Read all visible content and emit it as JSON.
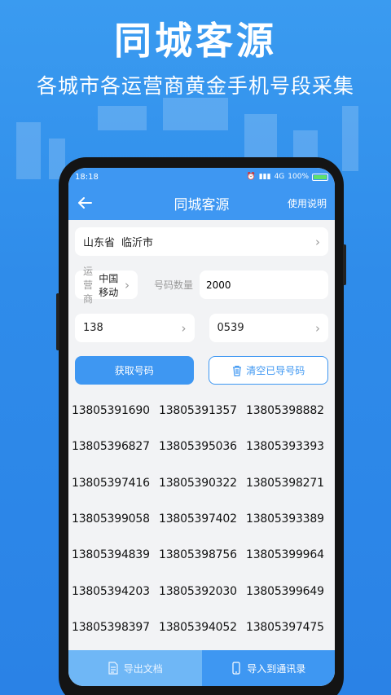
{
  "promo": {
    "title": "同城客源",
    "subtitle": "各城市各运营商黄金手机号段采集"
  },
  "statusbar": {
    "time": "18:18",
    "network": "4G",
    "battery": "100%"
  },
  "topbar": {
    "title": "同城客源",
    "help_label": "使用说明"
  },
  "location": {
    "province": "山东省",
    "city": "临沂市"
  },
  "carrier": {
    "label": "运营商",
    "value": "中国移动"
  },
  "count": {
    "label": "号码数量",
    "value": "2000"
  },
  "prefix": {
    "value": "138"
  },
  "area_code": {
    "value": "0539"
  },
  "actions": {
    "fetch_label": "获取号码",
    "clear_label": "清空已导号码"
  },
  "numbers": [
    "13805391690",
    "13805391357",
    "13805398882",
    "13805396827",
    "13805395036",
    "13805393393",
    "13805397416",
    "13805390322",
    "13805398271",
    "13805399058",
    "13805397402",
    "13805393389",
    "13805394839",
    "13805398756",
    "13805399964",
    "13805394203",
    "13805392030",
    "13805399649",
    "13805398397",
    "13805394052",
    "13805397475"
  ],
  "bottom": {
    "export_doc_label": "导出文档",
    "import_contacts_label": "导入到通讯录"
  },
  "colors": {
    "accent": "#3e97f2",
    "background": "#2f8cea"
  }
}
